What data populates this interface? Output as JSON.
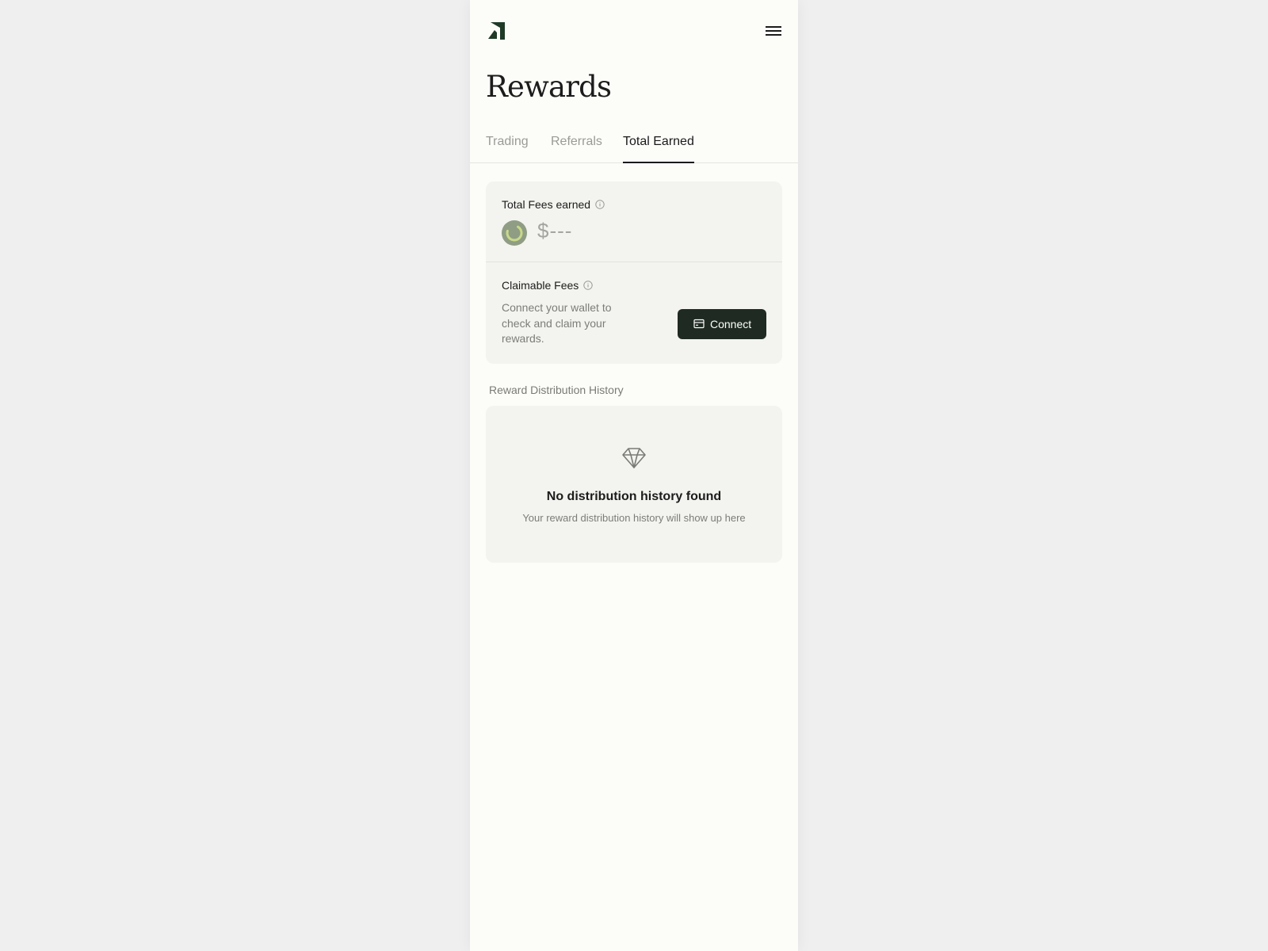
{
  "header": {
    "logo_icon": "brand-logo-icon",
    "menu_icon": "hamburger-menu-icon"
  },
  "page": {
    "title": "Rewards"
  },
  "tabs": [
    {
      "label": "Trading",
      "active": false
    },
    {
      "label": "Referrals",
      "active": false
    },
    {
      "label": "Total Earned",
      "active": true
    }
  ],
  "fees_card": {
    "total_label": "Total Fees earned",
    "total_value": "$---",
    "claimable_label": "Claimable Fees",
    "claimable_description": "Connect your wallet to check and claim your rewards.",
    "connect_label": "Connect"
  },
  "history": {
    "section_label": "Reward Distribution History",
    "empty_title": "No distribution history found",
    "empty_subtitle": "Your reward distribution history will show up here",
    "empty_icon": "diamond-icon"
  },
  "colors": {
    "page_bg": "#efefef",
    "frame_bg": "#fcfcf9",
    "card_bg": "#f3f3ef",
    "button_bg": "#1f2b22",
    "brand_dark": "#1f3a27",
    "spinner_accent": "#c8d98a"
  }
}
